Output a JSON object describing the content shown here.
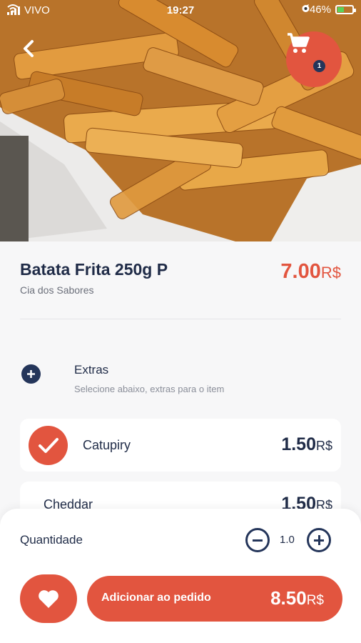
{
  "status_bar": {
    "carrier": "VIVO",
    "time": "19:27",
    "battery": "46%",
    "battery_level": 0.46
  },
  "header": {
    "cart_count": "1"
  },
  "product": {
    "name": "Batata Frita 250g P",
    "store": "Cia dos Sabores",
    "price": "7.00",
    "currency": "R$"
  },
  "extras": {
    "title": "Extras",
    "subtitle": "Selecione abaixo, extras para o item",
    "items": [
      {
        "name": "Catupiry",
        "price": "1.50",
        "currency": "R$",
        "selected": true
      },
      {
        "name": "Cheddar",
        "price": "1.50",
        "currency": "R$",
        "selected": false
      }
    ]
  },
  "order": {
    "quantity_label": "Quantidade",
    "quantity": "1.0",
    "add_label": "Adicionar ao pedido",
    "total": "8.50",
    "currency": "R$"
  },
  "colors": {
    "accent": "#e2553f",
    "navy": "#24355a",
    "text": "#1f2b47"
  },
  "icons": [
    "back-arrow-icon",
    "cart-icon",
    "plus-icon",
    "check-icon",
    "minus-icon",
    "heart-icon"
  ]
}
